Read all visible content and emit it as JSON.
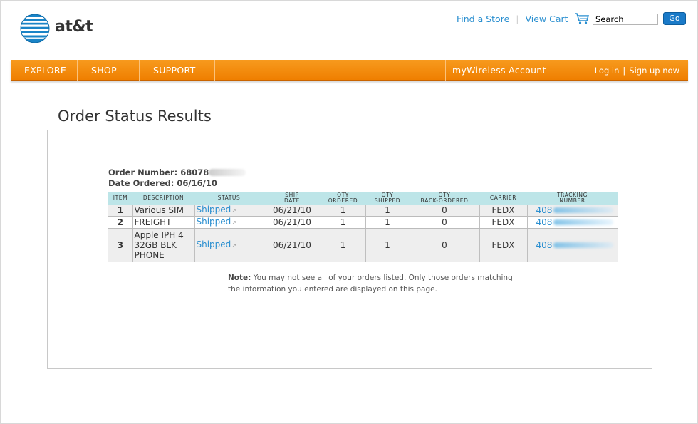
{
  "header": {
    "brand": "at&t",
    "find_store": "Find a Store",
    "view_cart": "View Cart",
    "search_value": "Search",
    "go_label": "Go"
  },
  "nav": {
    "items": [
      "EXPLORE",
      "SHOP",
      "SUPPORT"
    ],
    "account": "myWireless Account",
    "login": "Log in",
    "signup": "Sign up now"
  },
  "page": {
    "title": "Order Status Results",
    "order_number_label": "Order Number:",
    "order_number_value": "68078",
    "date_ordered_label": "Date Ordered:",
    "date_ordered_value": "06/16/10"
  },
  "table": {
    "headers": {
      "item": "ITEM",
      "description": "DESCRIPTION",
      "status": "STATUS",
      "ship_date_1": "SHIP",
      "ship_date_2": "DATE",
      "qty_ordered_1": "QTY",
      "qty_ordered_2": "ORDERED",
      "qty_shipped_1": "QTY",
      "qty_shipped_2": "SHIPPED",
      "qty_back_1": "QTY",
      "qty_back_2": "BACK-ORDERED",
      "carrier": "CARRIER",
      "tracking_1": "TRACKING",
      "tracking_2": "NUMBER"
    },
    "rows": [
      {
        "item": "1",
        "description_1": "Various SIM",
        "description_2": "",
        "description_3": "",
        "status": "Shipped",
        "ship_date": "06/21/10",
        "qty_ordered": "1",
        "qty_shipped": "1",
        "qty_back": "0",
        "carrier": "FEDX",
        "tracking": "408"
      },
      {
        "item": "2",
        "description_1": "FREIGHT",
        "description_2": "",
        "description_3": "",
        "status": "Shipped",
        "ship_date": "06/21/10",
        "qty_ordered": "1",
        "qty_shipped": "1",
        "qty_back": "0",
        "carrier": "FEDX",
        "tracking": "408"
      },
      {
        "item": "3",
        "description_1": "Apple IPH 4",
        "description_2": "32GB BLK",
        "description_3": "PHONE",
        "status": "Shipped",
        "ship_date": "06/21/10",
        "qty_ordered": "1",
        "qty_shipped": "1",
        "qty_back": "0",
        "carrier": "FEDX",
        "tracking": "408"
      }
    ]
  },
  "note": {
    "label": "Note:",
    "text": "You may not see all of your orders listed. Only those orders matching the information you entered are displayed on this page."
  },
  "colors": {
    "nav_orange": "#f08300",
    "link_blue": "#2a8fd0",
    "table_header": "#bde5e8",
    "go_button": "#1a7ac8"
  },
  "icons": [
    "att-globe-icon",
    "cart-icon",
    "external-link-icon"
  ]
}
